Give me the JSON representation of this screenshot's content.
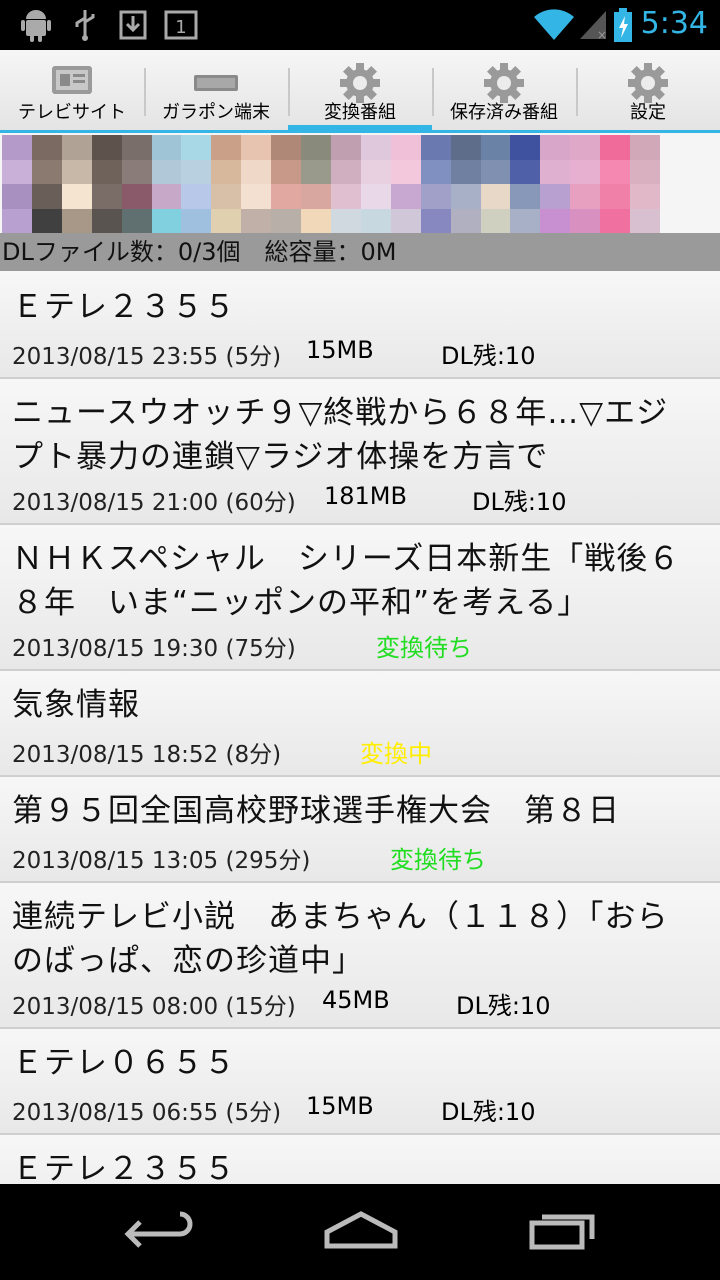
{
  "status_bar": {
    "time": "5:34",
    "icons": [
      "android-icon",
      "usb-icon",
      "download-icon",
      "notification-count-icon",
      "wifi-icon",
      "signal-icon",
      "battery-charging-icon"
    ],
    "notification_count": "1"
  },
  "tabs": [
    {
      "label": "テレビサイト",
      "icon": "tv-site-icon"
    },
    {
      "label": "ガラポン端末",
      "icon": "device-icon"
    },
    {
      "label": "変換番組",
      "icon": "gear-icon"
    },
    {
      "label": "保存済み番組",
      "icon": "gear-icon"
    },
    {
      "label": "設定",
      "icon": "gear-icon"
    }
  ],
  "active_tab": 2,
  "summary": {
    "text": "DLファイル数：0/3個　総容量：0M"
  },
  "programs": [
    {
      "title": "Ｅテレ２３５５",
      "datetime": "2013/08/15 23:55 (5分)",
      "size": "15MB",
      "status": "DL残:10",
      "status_type": "dl"
    },
    {
      "title": "ニュースウオッチ９▽終戦から６８年…▽エジプト暴力の連鎖▽ラジオ体操を方言で",
      "datetime": "2013/08/15 21:00 (60分)",
      "size": "181MB",
      "status": "DL残:10",
      "status_type": "dl"
    },
    {
      "title": "ＮＨＫスペシャル　シリーズ日本新生「戦後６８年　いま“ニッポンの平和”を考える」",
      "datetime": "2013/08/15 19:30 (75分)",
      "size": "",
      "status": "変換待ち",
      "status_type": "waiting"
    },
    {
      "title": "気象情報",
      "datetime": "2013/08/15 18:52 (8分)",
      "size": "",
      "status": "変換中",
      "status_type": "converting"
    },
    {
      "title": "第９５回全国高校野球選手権大会　第８日",
      "datetime": "2013/08/15 13:05 (295分)",
      "size": "",
      "status": "変換待ち",
      "status_type": "waiting"
    },
    {
      "title": "連続テレビ小説　あまちゃん（１１８）「おらのばっぱ、恋の珍道中」",
      "datetime": "2013/08/15 08:00 (15分)",
      "size": "45MB",
      "status": "DL残:10",
      "status_type": "dl"
    },
    {
      "title": "Ｅテレ０６５５",
      "datetime": "2013/08/15 06:55 (5分)",
      "size": "15MB",
      "status": "DL残:10",
      "status_type": "dl"
    },
    {
      "title": "Ｅテレ２３５５",
      "datetime": "",
      "size": "",
      "status": "",
      "status_type": ""
    }
  ],
  "colors": {
    "accent": "#33b5e5",
    "waiting": "#22dd22",
    "converting": "#ffee00",
    "summary_bg": "#9a9a9a"
  },
  "nav": [
    "back-icon",
    "home-icon",
    "recent-apps-icon"
  ]
}
